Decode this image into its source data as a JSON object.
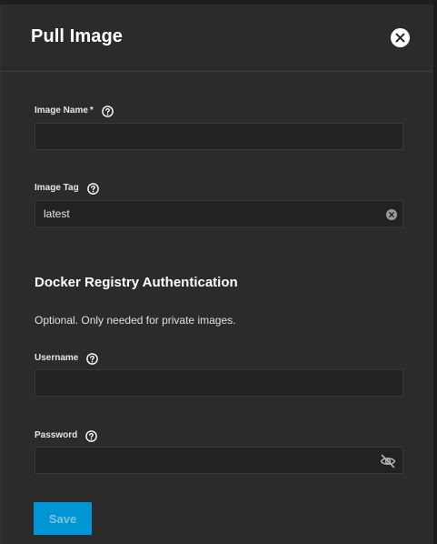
{
  "dialog": {
    "title": "Pull Image"
  },
  "fields": {
    "image_name": {
      "label": "Image Name",
      "required_marker": "*",
      "value": "",
      "placeholder": ""
    },
    "image_tag": {
      "label": "Image Tag",
      "value": "latest",
      "placeholder": ""
    },
    "username": {
      "label": "Username",
      "value": "",
      "placeholder": ""
    },
    "password": {
      "label": "Password",
      "value": "",
      "placeholder": ""
    }
  },
  "registry_section": {
    "title": "Docker Registry Authentication",
    "description": "Optional. Only needed for private images."
  },
  "actions": {
    "save_label": "Save",
    "save_disabled": true
  },
  "icons": {
    "close": "close-icon",
    "help": "help-circle-icon",
    "clear": "clear-icon",
    "visibility": "visibility-off-icon"
  },
  "colors": {
    "panel_bg": "#2b2b2b",
    "input_bg": "#222222",
    "primary": "#0095d5",
    "text": "#ffffff"
  }
}
